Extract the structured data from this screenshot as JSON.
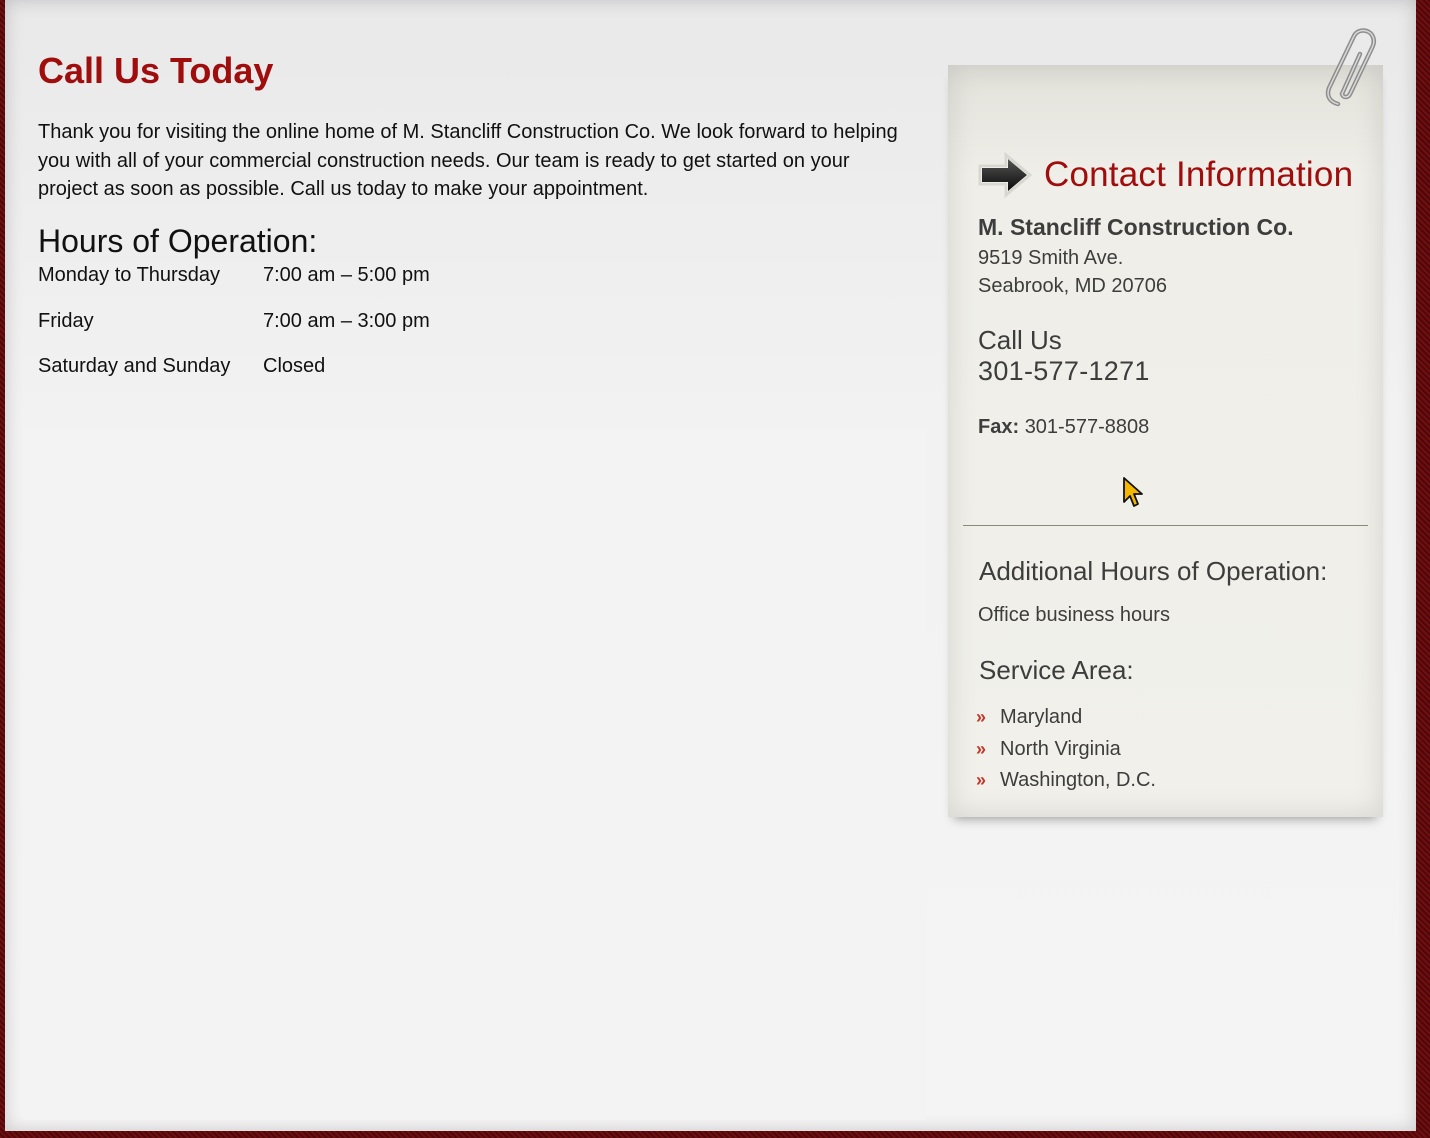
{
  "main": {
    "title": "Call Us Today",
    "intro": "Thank you for visiting the online home of M. Stancliff Construction Co. We look forward to helping you with all of your commercial construction needs. Our team is ready to get started on your project as soon as possible. Call us today to make your appointment.",
    "hours_title": "Hours of Operation:",
    "hours": [
      {
        "day": "Monday to Thursday",
        "time": "7:00 am – 5:00 pm"
      },
      {
        "day": "Friday",
        "time": "7:00 am – 3:00 pm"
      },
      {
        "day": "Saturday and Sunday",
        "time": "Closed"
      }
    ]
  },
  "sidebar": {
    "heading": "Contact Information",
    "company": "M. Stancliff Construction Co.",
    "address_line1": "9519 Smith Ave.",
    "address_line2": "Seabrook, MD 20706",
    "call_label": "Call Us",
    "phone": "301-577-1271",
    "fax_label": "Fax:",
    "fax": "301-577-8808",
    "additional_hours_title": "Additional Hours of Operation:",
    "additional_hours_text": "Office business hours",
    "service_area_title": "Service Area:",
    "service_areas": [
      "Maryland",
      "North Virginia",
      "Washington, D.C."
    ],
    "chevron_glyph": "»"
  },
  "colors": {
    "accent_red": "#a00d0d",
    "border_maroon": "#6e0f12",
    "bullet_red": "#c0392b"
  },
  "icons": {
    "heading_arrow": "arrow-right-icon",
    "paperclip": "paperclip-icon",
    "cursor": "mouse-cursor-icon"
  }
}
